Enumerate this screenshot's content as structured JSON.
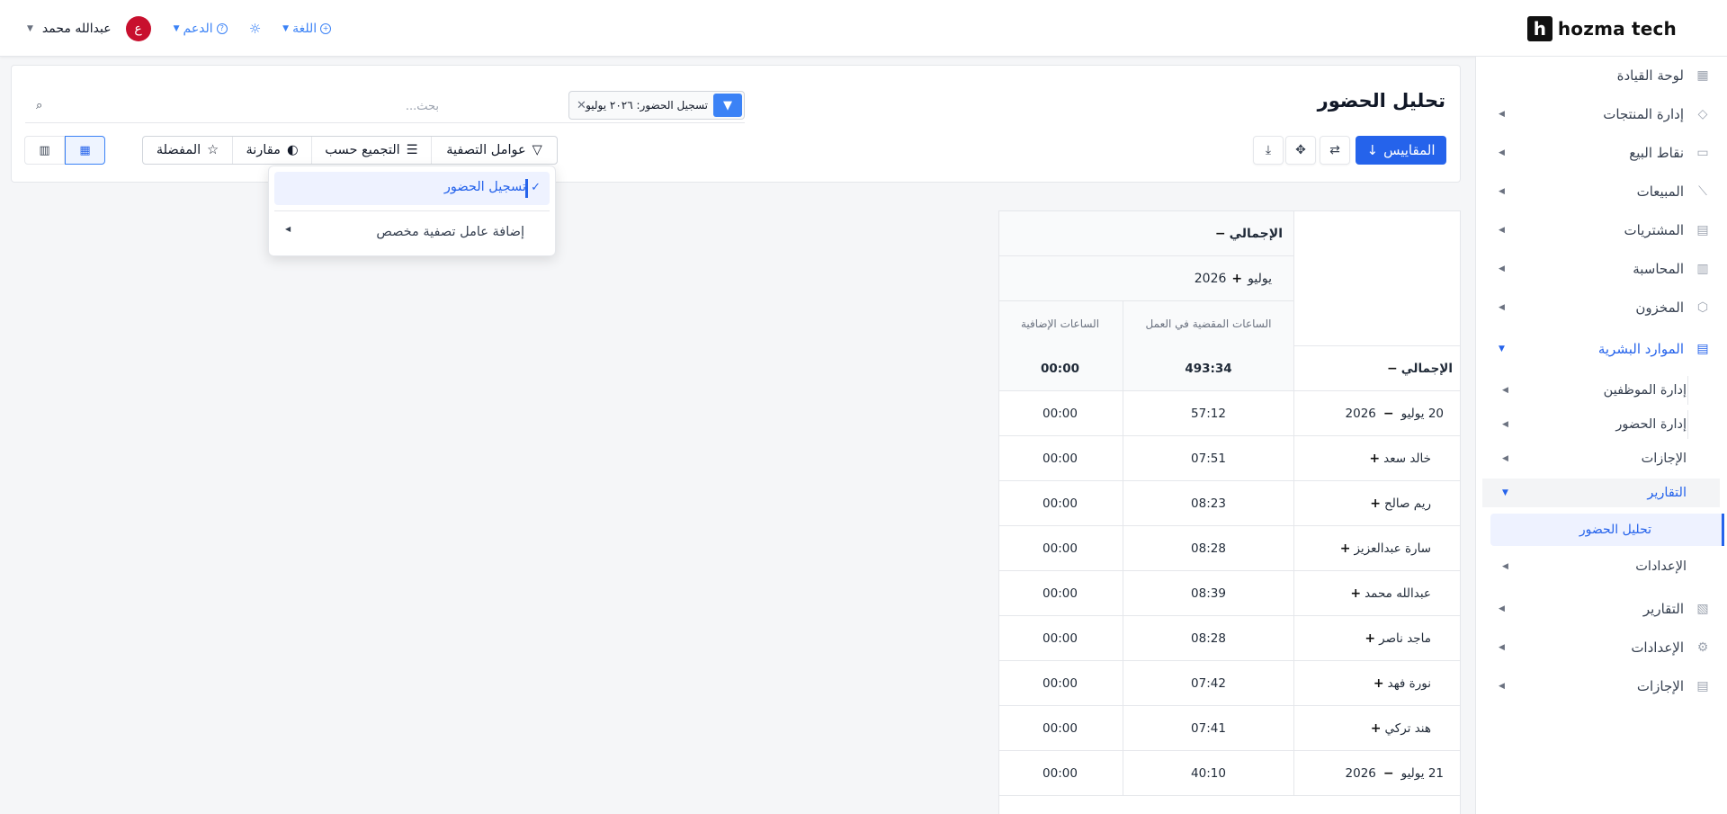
{
  "topbar": {
    "logo_mark": "h",
    "logo_text": "hozma tech",
    "user_name": "عبدالله محمد",
    "avatar_initial": "ع",
    "support_label": "الدعم",
    "language_label": "اللغة"
  },
  "sidebar": {
    "items": [
      {
        "label": "لوحة القيادة",
        "icon": "dashboard-grid-icon"
      },
      {
        "label": "إدارة المنتجات",
        "icon": "tag-icon"
      },
      {
        "label": "نقاط البيع",
        "icon": "store-icon"
      },
      {
        "label": "المبيعات",
        "icon": "chart-line-icon"
      },
      {
        "label": "المشتريات",
        "icon": "cart-icon"
      },
      {
        "label": "المحاسبة",
        "icon": "calculator-icon"
      },
      {
        "label": "المخزون",
        "icon": "box-icon"
      },
      {
        "label": "الموارد البشرية",
        "icon": "document-icon"
      },
      {
        "label": "التقارير",
        "icon": "report-icon"
      },
      {
        "label": "الإعدادات",
        "icon": "gear-icon"
      },
      {
        "label": "الإجازات",
        "icon": "clipboard-icon"
      }
    ],
    "hr_sub": [
      "إدارة الموظفين",
      "إدارة الحضور",
      "الإجازات",
      "التقارير",
      "الإعدادات"
    ],
    "active_leaf": "تحليل الحضور"
  },
  "page": {
    "title": "تحليل الحضور",
    "search_placeholder": "بحث...",
    "facet_label": "تسجيل الحضور: ٢٠٢٦ يوليو",
    "measures_button": "المقاييس",
    "filters_label": "عوامل التصفية",
    "groupby_label": "التجميع حسب",
    "compare_label": "مقارنة",
    "favorites_label": "المفضلة"
  },
  "dropdown": {
    "selected_item": "تسجيل الحضور",
    "custom_filter": "إضافة عامل تصفية مخصص"
  },
  "pivot": {
    "total_label": "الإجمالي",
    "period_label": "يوليو",
    "period_year": "2026",
    "col_hours": "الساعات المقضية في العمل",
    "col_overtime": "الساعات الإضافية",
    "rows": [
      {
        "label": "الإجمالي",
        "sign": "−",
        "hours": "493:34",
        "overtime": "00:00",
        "bold": true
      },
      {
        "label": "20 يوليو",
        "year": "2026",
        "sign": "−",
        "hours": "57:12",
        "overtime": "00:00"
      },
      {
        "label": "خالد سعد",
        "sign": "+",
        "hours": "07:51",
        "overtime": "00:00"
      },
      {
        "label": "ريم صالح",
        "sign": "+",
        "hours": "08:23",
        "overtime": "00:00"
      },
      {
        "label": "سارة عبدالعزيز",
        "sign": "+",
        "hours": "08:28",
        "overtime": "00:00"
      },
      {
        "label": "عبدالله محمد",
        "sign": "+",
        "hours": "08:39",
        "overtime": "00:00"
      },
      {
        "label": "ماجد ناصر",
        "sign": "+",
        "hours": "08:28",
        "overtime": "00:00"
      },
      {
        "label": "نورة فهد",
        "sign": "+",
        "hours": "07:42",
        "overtime": "00:00"
      },
      {
        "label": "هند تركي",
        "sign": "+",
        "hours": "07:41",
        "overtime": "00:00"
      },
      {
        "label": "21 يوليو",
        "year": "2026",
        "sign": "−",
        "hours": "40:10",
        "overtime": "00:00"
      }
    ]
  },
  "colors": {
    "accent": "#2563eb",
    "avatar_bg": "#c8102e"
  }
}
